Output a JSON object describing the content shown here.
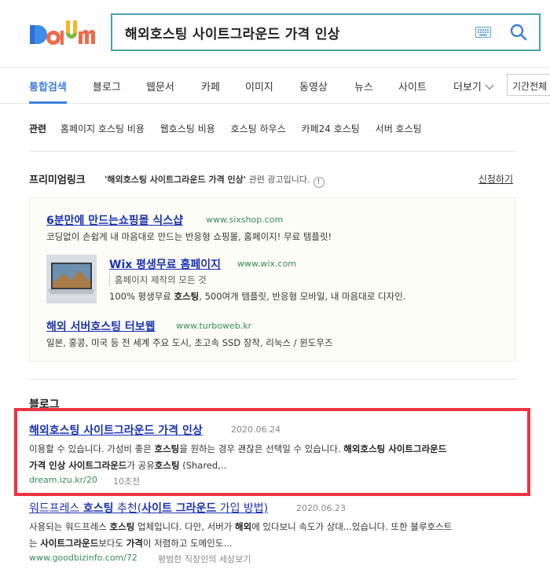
{
  "search": {
    "query": "해외호스팅 사이트그라운드 가격 인상"
  },
  "tabs": [
    {
      "label": "통합검색"
    },
    {
      "label": "블로그"
    },
    {
      "label": "웹문서"
    },
    {
      "label": "카페"
    },
    {
      "label": "이미지"
    },
    {
      "label": "동영상"
    },
    {
      "label": "뉴스"
    },
    {
      "label": "사이트"
    },
    {
      "label": "더보기"
    }
  ],
  "period": {
    "label": "기간전체"
  },
  "related": {
    "title": "관련",
    "items": [
      "홈페이지 호스팅 비용",
      "웹호스팅 비용",
      "호스팅 하우스",
      "카페24 호스팅",
      "서버 호스팅"
    ]
  },
  "premium": {
    "title": "프리미엄링크",
    "query_quote": "'해외호스팅 사이트그라운드 가격 인상'",
    "desc": " 관련 광고입니다.",
    "info": "!",
    "apply": "신청하기",
    "ads": [
      {
        "title": "6분만에 만드는쇼핑몰 식스샵",
        "url": "www.sixshop.com",
        "desc": "코딩없이 손쉽게 내 마음대로 만드는 반응형 쇼핑몰, 홈페이지! 무료 템플릿!"
      },
      {
        "title": "Wix 평생무료 홈페이지",
        "url": "www.wix.com",
        "sub": "홈페이지 제작의 모든 것",
        "desc_pre": "100% 평생무료 ",
        "desc_bold": "호스팅",
        "desc_post": ", 500여개 템플릿, 반응형 모바일, 내 마음대로 디자인."
      },
      {
        "title": "해외 서버호스팅 터보웹",
        "url": "www.turboweb.kr",
        "desc": "일본, 홍콩, 미국 등 전 세계 주요 도시, 초고속 SSD 장착, 리눅스 / 윈도우즈"
      }
    ]
  },
  "blog": {
    "label": "블로그",
    "results": [
      {
        "title": "해외호스팅 사이트그라운드 가격 인상",
        "date": "2020.06.24",
        "line1_a": "이용할 수 있습니다. 가성비 좋은 ",
        "line1_b": "호스팅",
        "line1_c": "을 원하는 경우 괜찮은 선택일 수 있습니다. ",
        "line1_d": "해외호스팅 사이트그라운드",
        "line2_a": "가격 인상 사이트그라운드",
        "line2_b": "가 공유",
        "line2_c": "호스팅",
        "line2_d": " (Shared,..",
        "url": "dream.izu.kr/20",
        "meta": "10초전"
      },
      {
        "title_a": "워드프레스 ",
        "title_b": "호스팅",
        "title_c": " 추천(",
        "title_d": "사이트 그라운드",
        "title_e": " 가입 방법)",
        "date": "2020.06.23",
        "line1_a": "사용되는 워드프레스 ",
        "line1_b": "호스팅",
        "line1_c": " 업체입니다. 다만, 서버가 ",
        "line1_d": "해외",
        "line1_e": "에 있다보니 속도가 상대...있습니다. 또한 블루호스트",
        "line2_a": "는 ",
        "line2_b": "사이트그라운드",
        "line2_c": "보다도 ",
        "line2_d": "가격",
        "line2_e": "이 저렴하고 도메인도...",
        "url": "www.goodbizinfo.com/72",
        "meta": "평범한 직장인의 세상보기"
      }
    ]
  },
  "colors": {
    "accent": "#3e7ce0",
    "search_border": "#44a4ad",
    "link": "#1a33b2",
    "url": "#3a8a5c",
    "highlight": "#ef3340"
  }
}
